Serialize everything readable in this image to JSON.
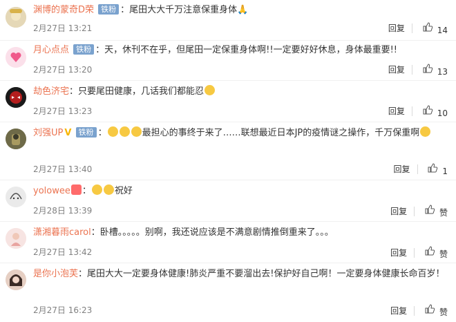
{
  "comments": [
    {
      "user": "渊博的蒙奇D荣",
      "badge": "铁粉",
      "sep": "：",
      "text": "尾田大大千万注意保重身体🙏",
      "time": "2月27日 13:21",
      "reply": "回复",
      "likes": "14",
      "emoji": false
    },
    {
      "user": "月心点点",
      "badge": "铁粉",
      "sep": "：",
      "text": "天，休刊不在乎，但尾田一定保重身体啊!!一定要好好休息，身体最重要!!",
      "time": "2月27日 13:20",
      "reply": "回复",
      "likes": "13",
      "emoji": false
    },
    {
      "user": "劫色济宅",
      "badge": "",
      "sep": "：",
      "text": "只要尾田健康，几话我们都能忍",
      "time": "2月27日 13:23",
      "reply": "回复",
      "likes": "10",
      "emoji": true
    },
    {
      "user": "刘强UP",
      "badge": "铁粉",
      "sep": "：",
      "text": "最担心的事终于来了……联想最近日本JP的疫情谜之操作，千万保重啊",
      "time": "2月27日 13:40",
      "reply": "回复",
      "likes": "1",
      "emoji": true
    },
    {
      "user": "yolowee",
      "badge": "",
      "sep": "：",
      "text": "祝好",
      "time": "2月28日 13:39",
      "reply": "回复",
      "likes": "赞",
      "emoji": true
    },
    {
      "user": "潇湘暮雨carol",
      "badge": "",
      "sep": "：",
      "text": "卧槽。。。。。别啊，我还说应该是不满意剧情推倒重来了。。。",
      "time": "2月27日 13:42",
      "reply": "回复",
      "likes": "赞",
      "emoji": false
    },
    {
      "user": "是你小泡芙",
      "badge": "",
      "sep": "：",
      "text": "尾田大大一定要身体健康!肺炎严重不要溜出去!保护好自己啊！一定要身体健康长命百岁！",
      "time": "2月27日 16:23",
      "reply": "回复",
      "likes": "赞",
      "emoji": false
    }
  ],
  "colors": {
    "username": "#eb7350",
    "badge": "#7aa2ce",
    "meta": "#808080"
  },
  "icons": {
    "like": "thumb-up-icon"
  }
}
